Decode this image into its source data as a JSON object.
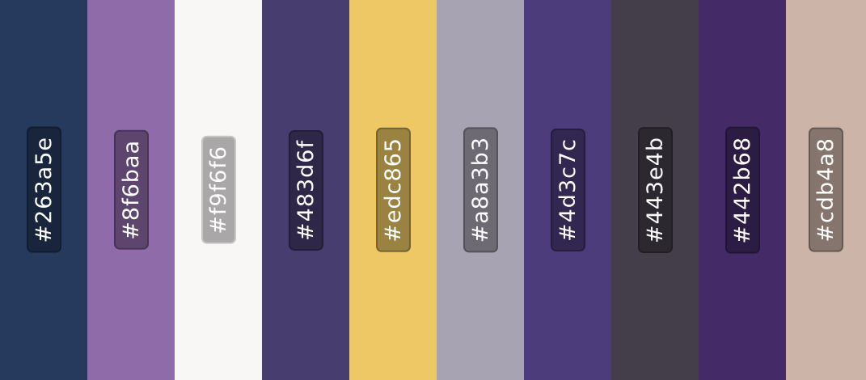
{
  "swatches": [
    {
      "hex": "#263a5e",
      "color": "#263a5e"
    },
    {
      "hex": "#8f6baa",
      "color": "#8f6baa"
    },
    {
      "hex": "#f9f6f6",
      "color": "#f9f6f6"
    },
    {
      "hex": "#483d6f",
      "color": "#483d6f"
    },
    {
      "hex": "#edc865",
      "color": "#edc865"
    },
    {
      "hex": "#a8a3b3",
      "color": "#a8a3b3"
    },
    {
      "hex": "#4d3c7c",
      "color": "#4d3c7c"
    },
    {
      "hex": "#443e4b",
      "color": "#443e4b"
    },
    {
      "hex": "#442b68",
      "color": "#442b68"
    },
    {
      "hex": "#cdb4a8",
      "color": "#cdb4a8"
    }
  ]
}
